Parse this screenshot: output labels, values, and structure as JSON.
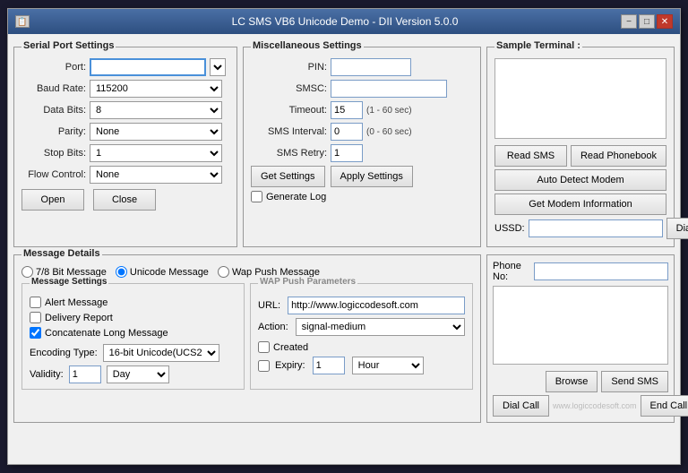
{
  "window": {
    "title": "LC SMS VB6 Unicode Demo - DII Version 5.0.0"
  },
  "titlebar": {
    "minimize": "−",
    "maximize": "□",
    "close": "✕"
  },
  "serial_port": {
    "label": "Serial Port Settings",
    "port_label": "Port:",
    "port_value": "",
    "baud_label": "Baud Rate:",
    "baud_value": "115200",
    "data_bits_label": "Data Bits:",
    "data_bits_value": "8",
    "parity_label": "Parity:",
    "parity_value": "None",
    "stop_bits_label": "Stop Bits:",
    "stop_bits_value": "1",
    "flow_label": "Flow Control:",
    "flow_value": "None",
    "open_btn": "Open",
    "close_btn": "Close"
  },
  "misc": {
    "label": "Miscellaneous Settings",
    "pin_label": "PIN:",
    "pin_value": "",
    "smsc_label": "SMSC:",
    "smsc_value": "",
    "timeout_label": "Timeout:",
    "timeout_value": "15",
    "timeout_hint": "(1 - 60 sec)",
    "interval_label": "SMS Interval:",
    "interval_value": "0",
    "interval_hint": "(0 - 60 sec)",
    "retry_label": "SMS Retry:",
    "retry_value": "1",
    "get_settings_btn": "Get Settings",
    "apply_settings_btn": "Apply Settings",
    "gen_log_label": "Generate Log"
  },
  "terminal": {
    "label": "Sample Terminal :",
    "read_sms_btn": "Read SMS",
    "read_phonebook_btn": "Read Phonebook",
    "auto_detect_btn": "Auto Detect Modem",
    "get_modem_btn": "Get Modem Information",
    "ussd_label": "USSD:",
    "ussd_value": "",
    "dial_ussd_btn": "Dial USSD"
  },
  "message": {
    "label": "Message Details",
    "radio_7_8": "7/8 Bit Message",
    "radio_unicode": "Unicode Message",
    "radio_wap": "Wap Push Message",
    "settings_label": "Message Settings",
    "alert_label": "Alert Message",
    "delivery_label": "Delivery Report",
    "concat_label": "Concatenate Long Message",
    "encoding_label": "Encoding Type:",
    "encoding_value": "16-bit Unicode(UCS2",
    "validity_label": "Validity:",
    "validity_value": "1",
    "validity_unit": "Day",
    "wap_label": "WAP Push Parameters",
    "url_label": "URL:",
    "url_value": "http://www.logiccodesoft.com",
    "action_label": "Action:",
    "action_value": "signal-medium",
    "created_label": "Created",
    "expiry_label": "Expiry:",
    "expiry_value": "1",
    "expiry_unit": "Hour"
  },
  "phone": {
    "phone_no_label": "Phone No:",
    "phone_no_value": "",
    "browse_btn": "Browse",
    "send_sms_btn": "Send SMS",
    "dial_call_btn": "Dial Call",
    "watermark": "www.logiccodesoft.com",
    "end_call_btn": "End Call"
  }
}
